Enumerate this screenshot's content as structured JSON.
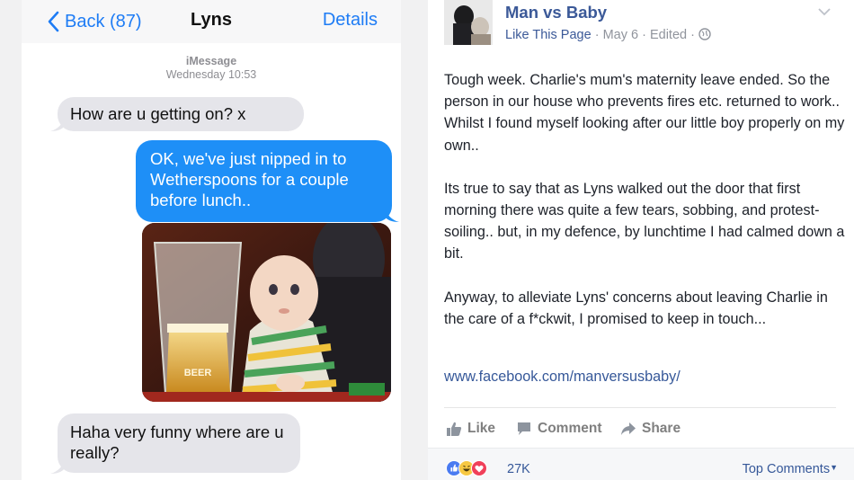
{
  "imessage": {
    "nav": {
      "back_label": "Back (87)",
      "contact_name": "Lyns",
      "details_label": "Details"
    },
    "meta": {
      "service": "iMessage",
      "timestamp": "Wednesday 10:53"
    },
    "messages": [
      {
        "direction": "incoming",
        "text": "How are u getting on? x"
      },
      {
        "direction": "outgoing",
        "text": "OK, we've just nipped in to Wetherspoons for a couple before lunch.."
      },
      {
        "direction": "incoming",
        "text": "Haha very funny where are u really?"
      }
    ],
    "photo": {
      "glass_label": "BEER"
    },
    "colors": {
      "accent": "#1e7cf5",
      "outgoing_bubble": "#1e8ff7",
      "incoming_bubble": "#e5e5ea"
    }
  },
  "facebook": {
    "page_name": "Man vs Baby",
    "meta": {
      "like_page": "Like This Page",
      "sep": "·",
      "date": "May 6",
      "edited": "Edited",
      "privacy_icon": "globe-icon"
    },
    "post": {
      "paragraphs": [
        "Tough week. Charlie's mum's maternity leave ended. So the person in our house who prevents fires etc. returned to work.. Whilst I found myself looking after our little boy properly on my own..",
        "Its true to say that as Lyns walked out the door that first morning there was quite a few tears, sobbing, and protest-soiling.. but, in my defence, by lunchtime I had calmed down a bit.",
        "Anyway, to alleviate Lyns' concerns about leaving Charlie in the care of a f*ckwit, I promised to keep in touch..."
      ],
      "link": "www.facebook.com/manversusbaby/"
    },
    "actions": {
      "like": "Like",
      "comment": "Comment",
      "share": "Share"
    },
    "footer": {
      "reaction_icons": [
        "like-reaction-icon",
        "haha-reaction-icon",
        "love-reaction-icon"
      ],
      "reaction_count": "27K",
      "sort_label": "Top Comments"
    },
    "colors": {
      "brand": "#3b5998",
      "link": "#365899",
      "meta": "#90949c"
    }
  }
}
